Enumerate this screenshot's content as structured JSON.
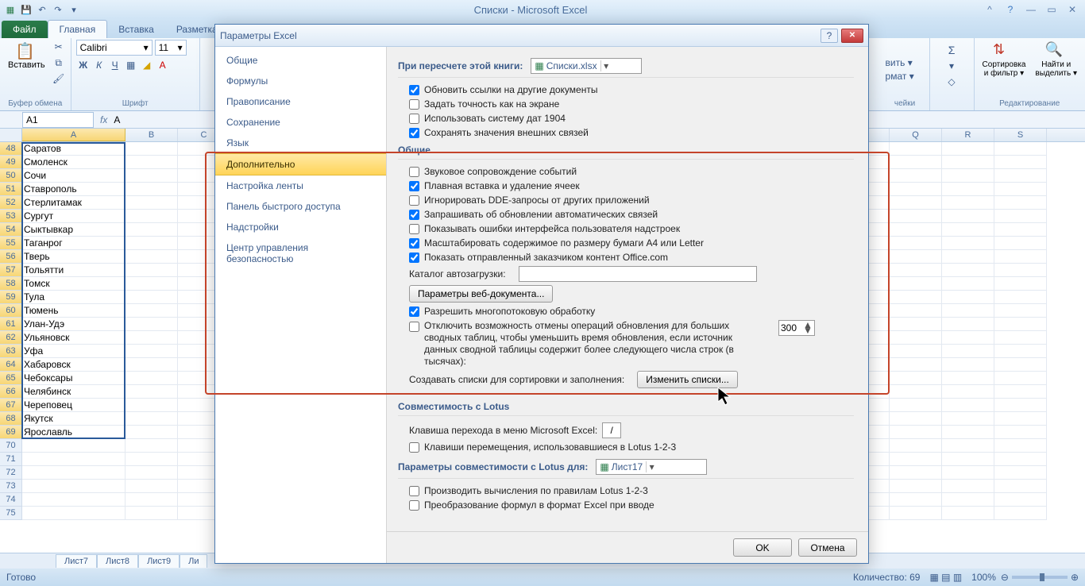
{
  "titlebar": {
    "title": "Списки  -  Microsoft Excel"
  },
  "ribbon": {
    "file": "Файл",
    "tabs": [
      "Главная",
      "Вставка",
      "Разметка"
    ],
    "active_tab": 0,
    "clipboard": {
      "paste": "Вставить",
      "label": "Буфер обмена"
    },
    "font": {
      "name": "Calibri",
      "size": "11",
      "label": "Шрифт"
    },
    "cells": {
      "insert": "вить ▾",
      "format": "рмат ▾",
      "label": "чейки"
    },
    "editing": {
      "sort": "Сортировка\nи фильтр ▾",
      "find": "Найти и\nвыделить ▾",
      "label": "Редактирование"
    }
  },
  "formula": {
    "namebox": "A1",
    "fx": "fx",
    "value": "А"
  },
  "grid": {
    "cols": [
      "A",
      "B",
      "C",
      "",
      "",
      "",
      "",
      "",
      "",
      "",
      "",
      "",
      "",
      "",
      "",
      "",
      "",
      "Q",
      "R",
      "S"
    ],
    "rows_start": 47,
    "values": [
      "Саратов",
      "Смоленск",
      "Сочи",
      "Ставрополь",
      "Стерлитамак",
      "Сургут",
      "Сыктывкар",
      "Таганрог",
      "Тверь",
      "Тольятти",
      "Томск",
      "Тула",
      "Тюмень",
      "Улан-Удэ",
      "Ульяновск",
      "Уфа",
      "Хабаровск",
      "Чебоксары",
      "Челябинск",
      "Череповец",
      "Якутск",
      "Ярославль",
      "",
      "",
      "",
      "",
      "",
      ""
    ]
  },
  "sheets": [
    "Лист7",
    "Лист8",
    "Лист9",
    "Ли"
  ],
  "status": {
    "ready": "Готово",
    "count": "Количество: 69",
    "zoom": "100%"
  },
  "dialog": {
    "title": "Параметры Excel",
    "nav": [
      "Общие",
      "Формулы",
      "Правописание",
      "Сохранение",
      "Язык",
      "Дополнительно",
      "Настройка ленты",
      "Панель быстрого доступа",
      "Надстройки",
      "Центр управления безопасностью"
    ],
    "active_nav": 5,
    "sec_recalc": {
      "head": "При пересчете этой книги:",
      "combo": "Списки.xlsx",
      "o1": "Обновить ссылки на другие документы",
      "o2": "Задать точность как на экране",
      "o3": "Использовать систему дат 1904",
      "o4": "Сохранять значения внешних связей"
    },
    "sec_general": {
      "head": "Общие",
      "o1": "Звуковое сопровождение событий",
      "o2": "Плавная вставка и удаление ячеек",
      "o3": "Игнорировать DDE-запросы от других приложений",
      "o4": "Запрашивать об обновлении автоматических связей",
      "o5": "Показывать ошибки интерфейса пользователя надстроек",
      "o6": "Масштабировать содержимое по размеру бумаги A4 или Letter",
      "o7": "Показать отправленный заказчиком контент Office.com",
      "catalog_lbl": "Каталог автозагрузки:",
      "webparams": "Параметры веб-документа...",
      "o8": "Разрешить многопотоковую обработку",
      "o9": "Отключить возможность отмены операций обновления для больших сводных таблиц, чтобы уменьшить время обновления, если источник данных сводной таблицы содержит более следующего числа строк (в тысячах):",
      "spin": "300",
      "lists_lbl": "Создавать списки для сортировки и заполнения:",
      "lists_btn": "Изменить списки..."
    },
    "sec_lotus": {
      "head": "Совместимость с Lotus",
      "key_lbl": "Клавиша перехода в меню Microsoft Excel:",
      "key_val": "/",
      "o1": "Клавиши перемещения, использовавшиеся в Lotus 1-2-3"
    },
    "sec_lotus2": {
      "head": "Параметры совместимости с Lotus для:",
      "combo": "Лист17",
      "o1": "Производить вычисления по правилам Lotus 1-2-3",
      "o2": "Преобразование формул в формат Excel при вводе"
    },
    "ok": "OK",
    "cancel": "Отмена"
  }
}
